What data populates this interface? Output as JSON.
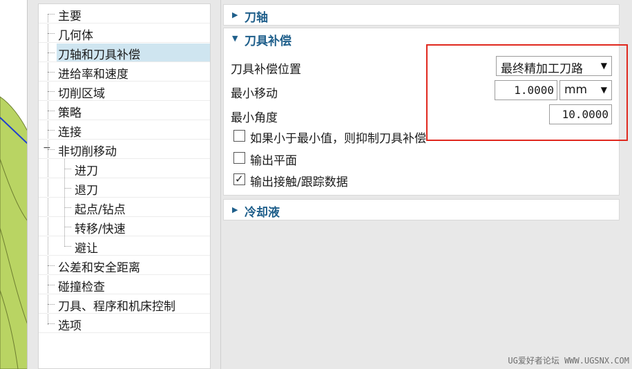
{
  "navigator": {
    "items": [
      {
        "label": "主要",
        "level": 0
      },
      {
        "label": "几何体",
        "level": 0
      },
      {
        "label": "刀轴和刀具补偿",
        "level": 0,
        "selected": true
      },
      {
        "label": "进给率和速度",
        "level": 0
      },
      {
        "label": "切削区域",
        "level": 0
      },
      {
        "label": "策略",
        "level": 0
      },
      {
        "label": "连接",
        "level": 0
      },
      {
        "label": "非切削移动",
        "level": 0,
        "expanded": true
      },
      {
        "label": "进刀",
        "level": 1
      },
      {
        "label": "退刀",
        "level": 1
      },
      {
        "label": "起点/钻点",
        "level": 1
      },
      {
        "label": "转移/快速",
        "level": 1
      },
      {
        "label": "避让",
        "level": 1
      },
      {
        "label": "公差和安全距离",
        "level": 0
      },
      {
        "label": "碰撞检查",
        "level": 0
      },
      {
        "label": "刀具、程序和机床控制",
        "level": 0
      },
      {
        "label": "选项",
        "level": 0
      }
    ],
    "collapse_glyph": "−"
  },
  "groups": {
    "tool_axis": {
      "title": "刀轴",
      "arrow": "▶",
      "expanded": false
    },
    "tool_comp": {
      "title": "刀具补偿",
      "arrow": "▼",
      "expanded": true,
      "position_label": "刀具补偿位置",
      "position_value": "最终精加工刀路",
      "min_move_label": "最小移动",
      "min_move_value": "1.0000",
      "min_move_unit": "mm",
      "min_angle_label": "最小角度",
      "min_angle_value": "10.0000",
      "cb_suppress_label": "如果小于最小值，则抑制刀具补偿",
      "cb_suppress_checked": false,
      "cb_output_plane_label": "输出平面",
      "cb_output_plane_checked": false,
      "cb_output_contact_label": "输出接触/跟踪数据",
      "cb_output_contact_checked": true
    },
    "coolant": {
      "title": "冷却液",
      "arrow": "▶",
      "expanded": false
    }
  },
  "icons": {
    "caret": "caret-down-icon",
    "check": "check-icon"
  },
  "glyphs": {
    "caret": "▼",
    "check": "✓"
  },
  "colors": {
    "header_text": "#1f5f8b",
    "selected_bg": "#cfe5f0",
    "highlight_box": "#e0281e",
    "part_green": "#b9d463"
  },
  "watermark": "UG爱好者论坛 WWW.UGSNX.COM"
}
